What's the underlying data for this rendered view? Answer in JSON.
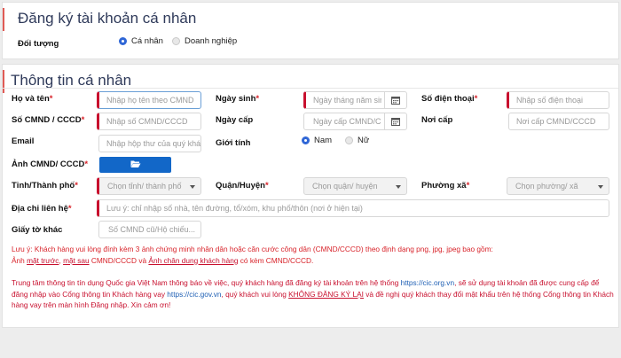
{
  "header": {
    "title": "Đăng ký tài khoản cá nhân",
    "subject_label": "Đối tượng",
    "options": [
      {
        "label": "Cá nhân",
        "selected": true
      },
      {
        "label": "Doanh nghiệp",
        "selected": false
      }
    ]
  },
  "section": {
    "title": "Thông tin cá nhân"
  },
  "form": {
    "full_name": {
      "label": "Họ và tên",
      "required": "*",
      "placeholder": "Nhập họ tên theo CMND"
    },
    "dob": {
      "label": "Ngày sinh",
      "required": "*",
      "placeholder": "Ngày tháng năm sinh"
    },
    "phone": {
      "label": "Số điện thoại",
      "required": "*",
      "placeholder": "Nhập số điện thoại"
    },
    "id_number": {
      "label": "Số CMND / CCCD",
      "required": "*",
      "placeholder": "Nhập số CMND/CCCD"
    },
    "issue_date": {
      "label": "Ngày cấp",
      "placeholder": "Ngày cấp CMND/CCCD"
    },
    "issue_place": {
      "label": "Nơi cấp",
      "placeholder": "Nơi cấp CMND/CCCD"
    },
    "email": {
      "label": "Email",
      "placeholder": "Nhập hộp thư của quý khách"
    },
    "gender": {
      "label": "Giới tính",
      "options": [
        {
          "label": "Nam",
          "selected": true
        },
        {
          "label": "Nữ",
          "selected": false
        }
      ]
    },
    "id_photo": {
      "label": "Ảnh CMND/ CCCD",
      "required": "*",
      "button_icon": "folder-open-icon"
    },
    "province": {
      "label": "Tỉnh/Thành phố",
      "required": "*",
      "placeholder": "Chọn tỉnh/ thành phố"
    },
    "district": {
      "label": "Quận/Huyện",
      "required": "*",
      "placeholder": "Chọn quận/ huyện"
    },
    "ward": {
      "label": "Phường xã",
      "required": "*",
      "placeholder": "Chọn phường/ xã"
    },
    "address": {
      "label": "Địa chỉ liên hệ",
      "required": "*",
      "placeholder": "Lưu ý: chỉ nhập số nhà, tên đường, tổ/xóm, khu phố/thôn (nơi ở hiện tại)"
    },
    "other_docs": {
      "label": "Giấy tờ khác",
      "placeholder": "Số CMND cũ/Hộ chiếu..."
    }
  },
  "notice1": {
    "line1": "Lưu ý: Khách hàng vui lòng đính kèm 3 ảnh chứng minh nhân dân hoặc căn cước công dân (CMND/CCCD) theo định dạng png, jpg, jpeg bao gồm:",
    "line2_prefix": "Ảnh ",
    "front": "mặt trước",
    "sep1": ", ",
    "back": "mặt sau",
    "mid": " CMND/CCCD và ",
    "portrait": "Ảnh chân dung khách hàng",
    "suffix": " có kèm CMND/CCCD."
  },
  "notice2": {
    "part1": "Trung tâm thông tin tín dụng Quốc gia Việt Nam thông báo về việc, quý khách hàng đã đăng ký tài khoản trên hệ thống ",
    "link1": "https://cic.org.vn",
    "part2": ", sẽ sử dụng tài khoản đã được cung cấp để đăng nhập vào Cổng thông tin Khách hàng vay ",
    "link2": "https://cic.gov.vn",
    "part3": ", quý khách vui lòng ",
    "emph": "KHÔNG ĐĂNG KÝ LẠI",
    "part4": " và đề nghị quý khách thay đổi mật khẩu trên hệ thống Cổng thông tin Khách hàng vay trên màn hình Đăng nhập. Xin cảm ơn!"
  },
  "colors": {
    "accent_red": "#c8102e",
    "title_navy": "#2f3a5a",
    "button_blue": "#1267c8",
    "radio_blue": "#2f66d6"
  }
}
